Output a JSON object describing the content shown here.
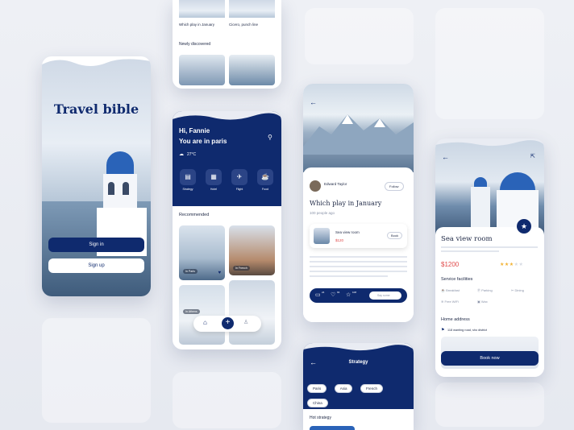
{
  "colors": {
    "navy": "#0f2a6e",
    "accent_red": "#e04a4a",
    "star": "#f2b233",
    "bg": "#e9ecf3"
  },
  "splash": {
    "title": "Travel bible",
    "signin": "Sign in",
    "signup": "Sign up"
  },
  "top_partial": {
    "card1_title": "Which play in January",
    "card2_title": "Cicero, punch line",
    "section": "Newly discovered"
  },
  "home": {
    "greeting": "Hi, Fannie",
    "location": "You are in paris",
    "weather": "27°C",
    "categories": [
      "Strategy",
      "Hotel",
      "Flight",
      "Food"
    ],
    "recommended": "Recommended",
    "tags": [
      "In Paris",
      "In French",
      "In Athens"
    ]
  },
  "detail": {
    "author": "Edward Taylor",
    "follow": "Follow",
    "title": "Which play in January",
    "subtitle": "100 people ago",
    "room_name": "Sea view room",
    "room_price": "$120",
    "book": "Book",
    "stats": [
      "24",
      "66",
      "108"
    ],
    "comment_placeholder": "Say some"
  },
  "strategy": {
    "header": "Strategy",
    "tabs": [
      "Paris",
      "Asia",
      "French",
      "China"
    ],
    "section": "Hot strategy"
  },
  "room": {
    "title": "Sea view room",
    "price": "$1200",
    "facilities_title": "Service facilities",
    "facilities": [
      "Breakfast",
      "Parking",
      "Dining",
      "Free WiFi",
      "Wax"
    ],
    "address_title": "Home address",
    "address": "118 wanting road, sho district",
    "book_now": "Book now"
  }
}
